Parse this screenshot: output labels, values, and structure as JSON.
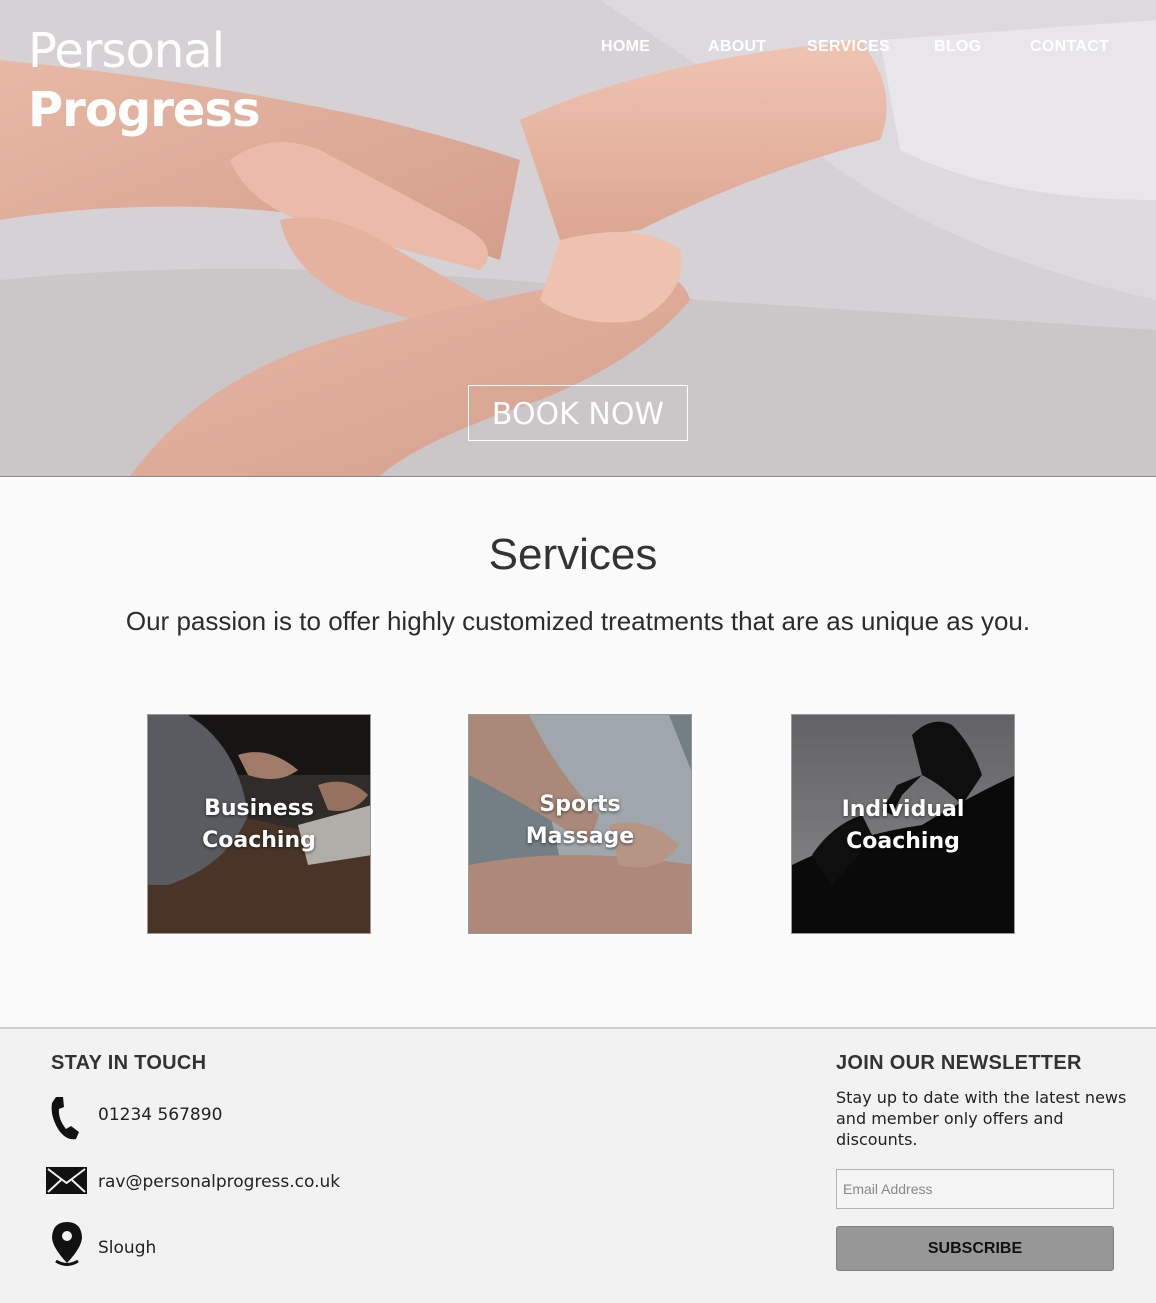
{
  "brand": {
    "line1": "Personal",
    "line2": "Progress"
  },
  "nav": [
    {
      "label": "HOME"
    },
    {
      "label": "ABOUT"
    },
    {
      "label": "SERVICES"
    },
    {
      "label": "BLOG"
    },
    {
      "label": "CONTACT"
    }
  ],
  "hero": {
    "cta_label": "BOOK NOW"
  },
  "services": {
    "title": "Services",
    "subtitle": "Our passion is to offer highly customized treatments that are as unique as you.",
    "cards": [
      {
        "line1": "Business",
        "line2": "Coaching"
      },
      {
        "line1": "Sports",
        "line2": "Massage"
      },
      {
        "line1": "Individual",
        "line2": "Coaching"
      }
    ]
  },
  "footer": {
    "contact_heading": "STAY IN TOUCH",
    "phone": "01234 567890",
    "email": "rav@personalprogress.co.uk",
    "location": "Slough",
    "newsletter_heading": "JOIN OUR NEWSLETTER",
    "newsletter_text": "Stay up to date with the latest news and member only offers and discounts.",
    "email_placeholder": "Email Address",
    "subscribe_label": "SUBSCRIBE"
  },
  "icons": [
    "phone-icon",
    "envelope-icon",
    "map-pin-icon"
  ]
}
